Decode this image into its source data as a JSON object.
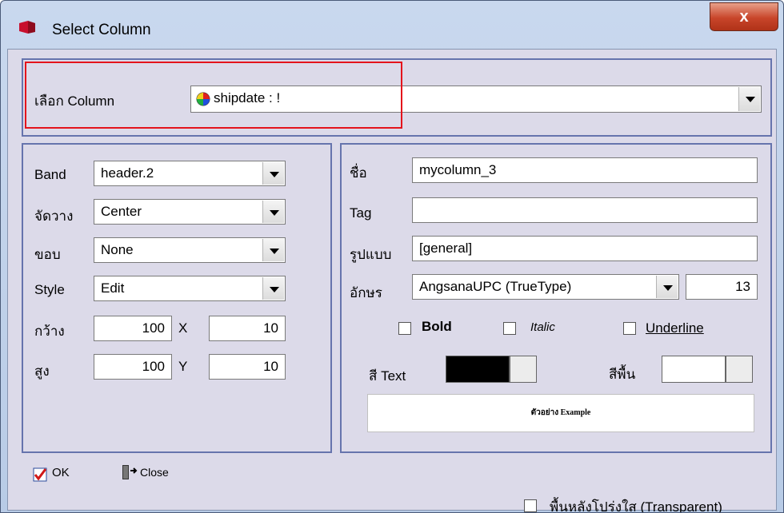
{
  "window": {
    "title": "Select Column",
    "close_label": "x"
  },
  "column_select": {
    "label": "เลือก Column",
    "value": "shipdate : !"
  },
  "left": {
    "band_label": "Band",
    "band_value": "header.2",
    "align_label": "จัดวาง",
    "align_value": "Center",
    "border_label": "ขอบ",
    "border_value": "None",
    "style_label": "Style",
    "style_value": "Edit",
    "width_label": "กว้าง",
    "width_value": "100",
    "x_label": "X",
    "x_value": "10",
    "height_label": "สูง",
    "height_value": "100",
    "y_label": "Y",
    "y_value": "10"
  },
  "right": {
    "name_label": "ชื่อ",
    "name_value": "mycolumn_3",
    "tag_label": "Tag",
    "tag_value": "",
    "format_label": "รูปแบบ",
    "format_value": "[general]",
    "font_label": "อักษร",
    "font_value": "AngsanaUPC (TrueType)",
    "font_size": "13",
    "bold_label": "Bold",
    "italic_label": "Italic",
    "underline_label": "Underline",
    "text_color_label": "สี Text",
    "bg_color_label": "สีพื้น",
    "text_color": "#000000",
    "bg_color": "#ffffff",
    "preview": "ตัวอย่าง Example"
  },
  "footer": {
    "ok_label": "OK",
    "close_label": "Close",
    "transparent_label": "พื้นหลังโปร่งใส (Transparent)"
  }
}
